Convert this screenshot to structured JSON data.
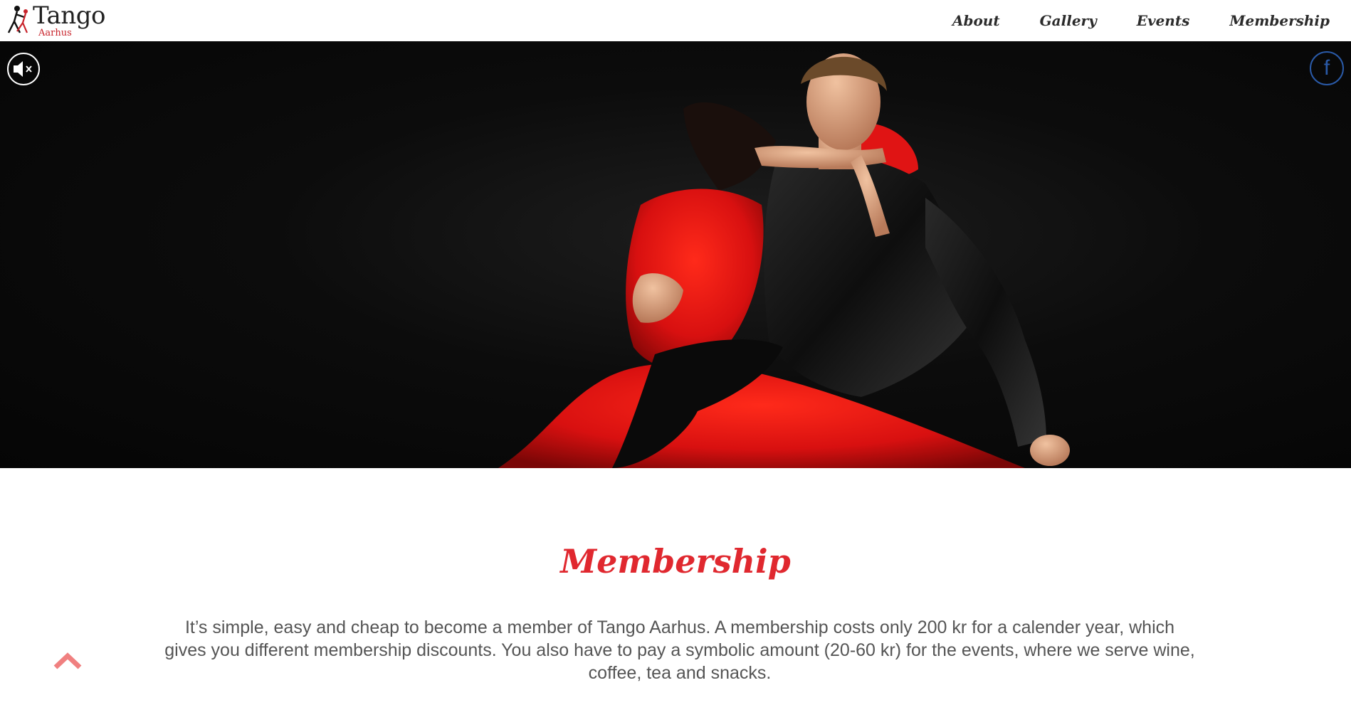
{
  "header": {
    "logo": {
      "title": "Tango",
      "subtitle": "Aarhus"
    },
    "nav": [
      {
        "label": "About"
      },
      {
        "label": "Gallery"
      },
      {
        "label": "Events"
      },
      {
        "label": "Membership"
      }
    ]
  },
  "hero": {
    "mute_icon": "speaker-muted-icon",
    "facebook_icon": "facebook-icon",
    "facebook_glyph": "f"
  },
  "content": {
    "title": "Membership",
    "intro": "It’s simple, easy and cheap to become a member of Tango Aarhus. A membership costs only 200 kr for a calender year, which gives you different membership discounts. You also have to pay a symbolic amount (20-60 kr) for the events, where we serve wine, coffee, tea and snacks."
  },
  "colors": {
    "accent": "#e0282f",
    "scroll_arrow": "#f08080",
    "facebook": "#2a5aa8"
  }
}
